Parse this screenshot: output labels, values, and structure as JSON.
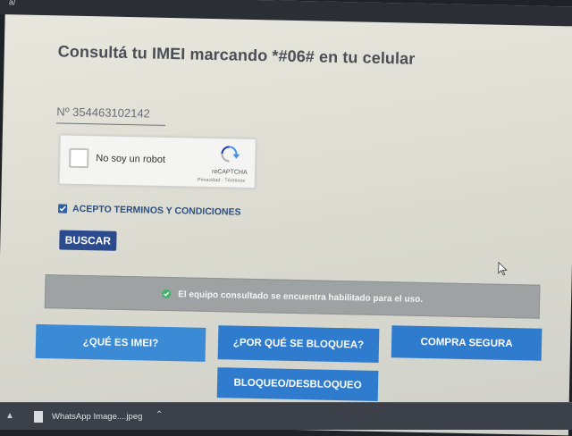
{
  "window": {
    "title_fragment": "a/"
  },
  "page": {
    "headline": "Consultá tu IMEI marcando *#06# en tu celular",
    "imei_field": {
      "value": "Nº 354463102142"
    },
    "recaptcha": {
      "label": "No soy un robot",
      "brand": "reCAPTCHA",
      "links": "Privacidad - Términos",
      "checked": false
    },
    "terms": {
      "label": "ACEPTO TERMINOS Y CONDICIONES",
      "checked": true
    },
    "search_button": "BUSCAR",
    "status_message": "El equipo consultado se encuentra habilitado para el uso.",
    "status_color": "#43b26c",
    "nav_buttons": [
      {
        "label": "¿QUÉ ES IMEI?"
      },
      {
        "label": "¿POR QUÉ SE BLOQUEA?"
      },
      {
        "label": "COMPRA SEGURA"
      },
      {
        "label": "BLOQUEO/DESBLOQUEO"
      }
    ],
    "accent_color": "#2f7ccf"
  },
  "taskbar": {
    "download_item": "WhatsApp Image....jpeg",
    "icons": [
      "chevron-up-icon",
      "file-icon",
      "chevron-up-icon"
    ]
  }
}
